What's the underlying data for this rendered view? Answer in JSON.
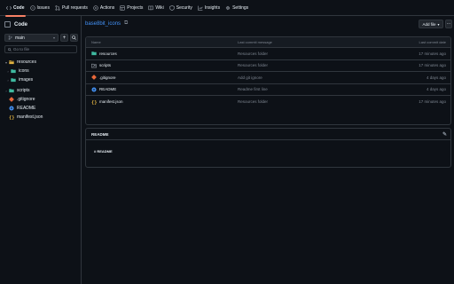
{
  "tabs": [
    {
      "label": "Code",
      "icon": "code-icon"
    },
    {
      "label": "Issues",
      "icon": "issue-icon"
    },
    {
      "label": "Pull requests",
      "icon": "pull-request-icon"
    },
    {
      "label": "Actions",
      "icon": "play-icon"
    },
    {
      "label": "Projects",
      "icon": "table-icon"
    },
    {
      "label": "Wiki",
      "icon": "book-icon"
    },
    {
      "label": "Security",
      "icon": "shield-icon"
    },
    {
      "label": "Insights",
      "icon": "graph-icon"
    },
    {
      "label": "Settings",
      "icon": "gear-icon"
    }
  ],
  "sidebar": {
    "title": "Code",
    "branch": "main",
    "search_placeholder": "Go to file",
    "tree": [
      {
        "name": "resources",
        "type": "folder-open",
        "depth": 0,
        "expanded": true
      },
      {
        "name": "icons",
        "type": "folder",
        "depth": 1,
        "expanded": false
      },
      {
        "name": "images",
        "type": "folder",
        "depth": 1,
        "expanded": false
      },
      {
        "name": "scripts",
        "type": "folder",
        "depth": 0,
        "expanded": false
      },
      {
        "name": ".gitignore",
        "type": "gitignore",
        "depth": 0
      },
      {
        "name": "README",
        "type": "readme",
        "depth": 0
      },
      {
        "name": "manifest.json",
        "type": "json",
        "depth": 0
      }
    ]
  },
  "repo": {
    "name": "base8bit_icons"
  },
  "buttons": {
    "add_file": "Add file",
    "more": "···"
  },
  "table": {
    "headers": {
      "name": "Name",
      "commit": "Last commit message",
      "date": "Last commit date"
    },
    "rows": [
      {
        "name": "resources",
        "type": "folder",
        "message": "Resources folder",
        "date": "17 minutes ago"
      },
      {
        "name": "scripts",
        "type": "folder-link",
        "message": "Resources folder",
        "date": "17 minutes ago"
      },
      {
        "name": ".gitignore",
        "type": "gitignore",
        "message": "Add git ignore",
        "date": "4 days ago"
      },
      {
        "name": "README",
        "type": "readme",
        "message": "Readme first line",
        "date": "4 days ago"
      },
      {
        "name": "manifest.json",
        "type": "json",
        "message": "Resources folder",
        "date": "17 minutes ago"
      }
    ]
  },
  "readme": {
    "title": "README",
    "content": "# README"
  },
  "colors": {
    "folder": "#e2b340",
    "folder_alt": "#3fb9a0",
    "gitignore": "#e8683a",
    "readme": "#4493f8",
    "json": "#e2b340",
    "accent": "#f78166",
    "link": "#4493f8"
  }
}
